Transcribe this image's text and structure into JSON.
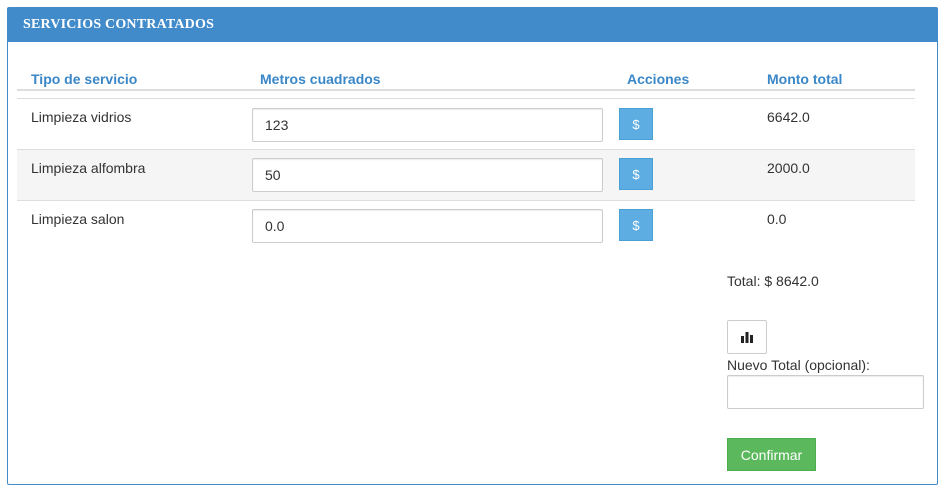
{
  "panel": {
    "title": "SERVICIOS CONTRATADOS"
  },
  "table": {
    "headers": {
      "tipo": "Tipo de servicio",
      "metros": "Metros cuadrados",
      "acciones": "Acciones",
      "monto": "Monto total"
    },
    "rows": [
      {
        "servicio": "Limpieza vidrios",
        "metros": "123",
        "accion_icon": "$",
        "monto": "6642.0"
      },
      {
        "servicio": "Limpieza alfombra",
        "metros": "50",
        "accion_icon": "$",
        "monto": "2000.0"
      },
      {
        "servicio": "Limpieza salon",
        "metros": "0.0",
        "accion_icon": "$",
        "monto": "0.0"
      }
    ]
  },
  "summary": {
    "total_text": "Total: $ 8642.0",
    "chart_icon": "bar-chart-icon",
    "nuevo_total_label": "Nuevo Total (opcional):",
    "nuevo_total_value": "",
    "confirm_label": "Confirmar"
  },
  "colors": {
    "primary": "#428bca",
    "header_text": "#3a87c8",
    "action_button": "#5dade2",
    "confirm_button": "#5cb85c",
    "stripe": "#f5f5f5"
  }
}
